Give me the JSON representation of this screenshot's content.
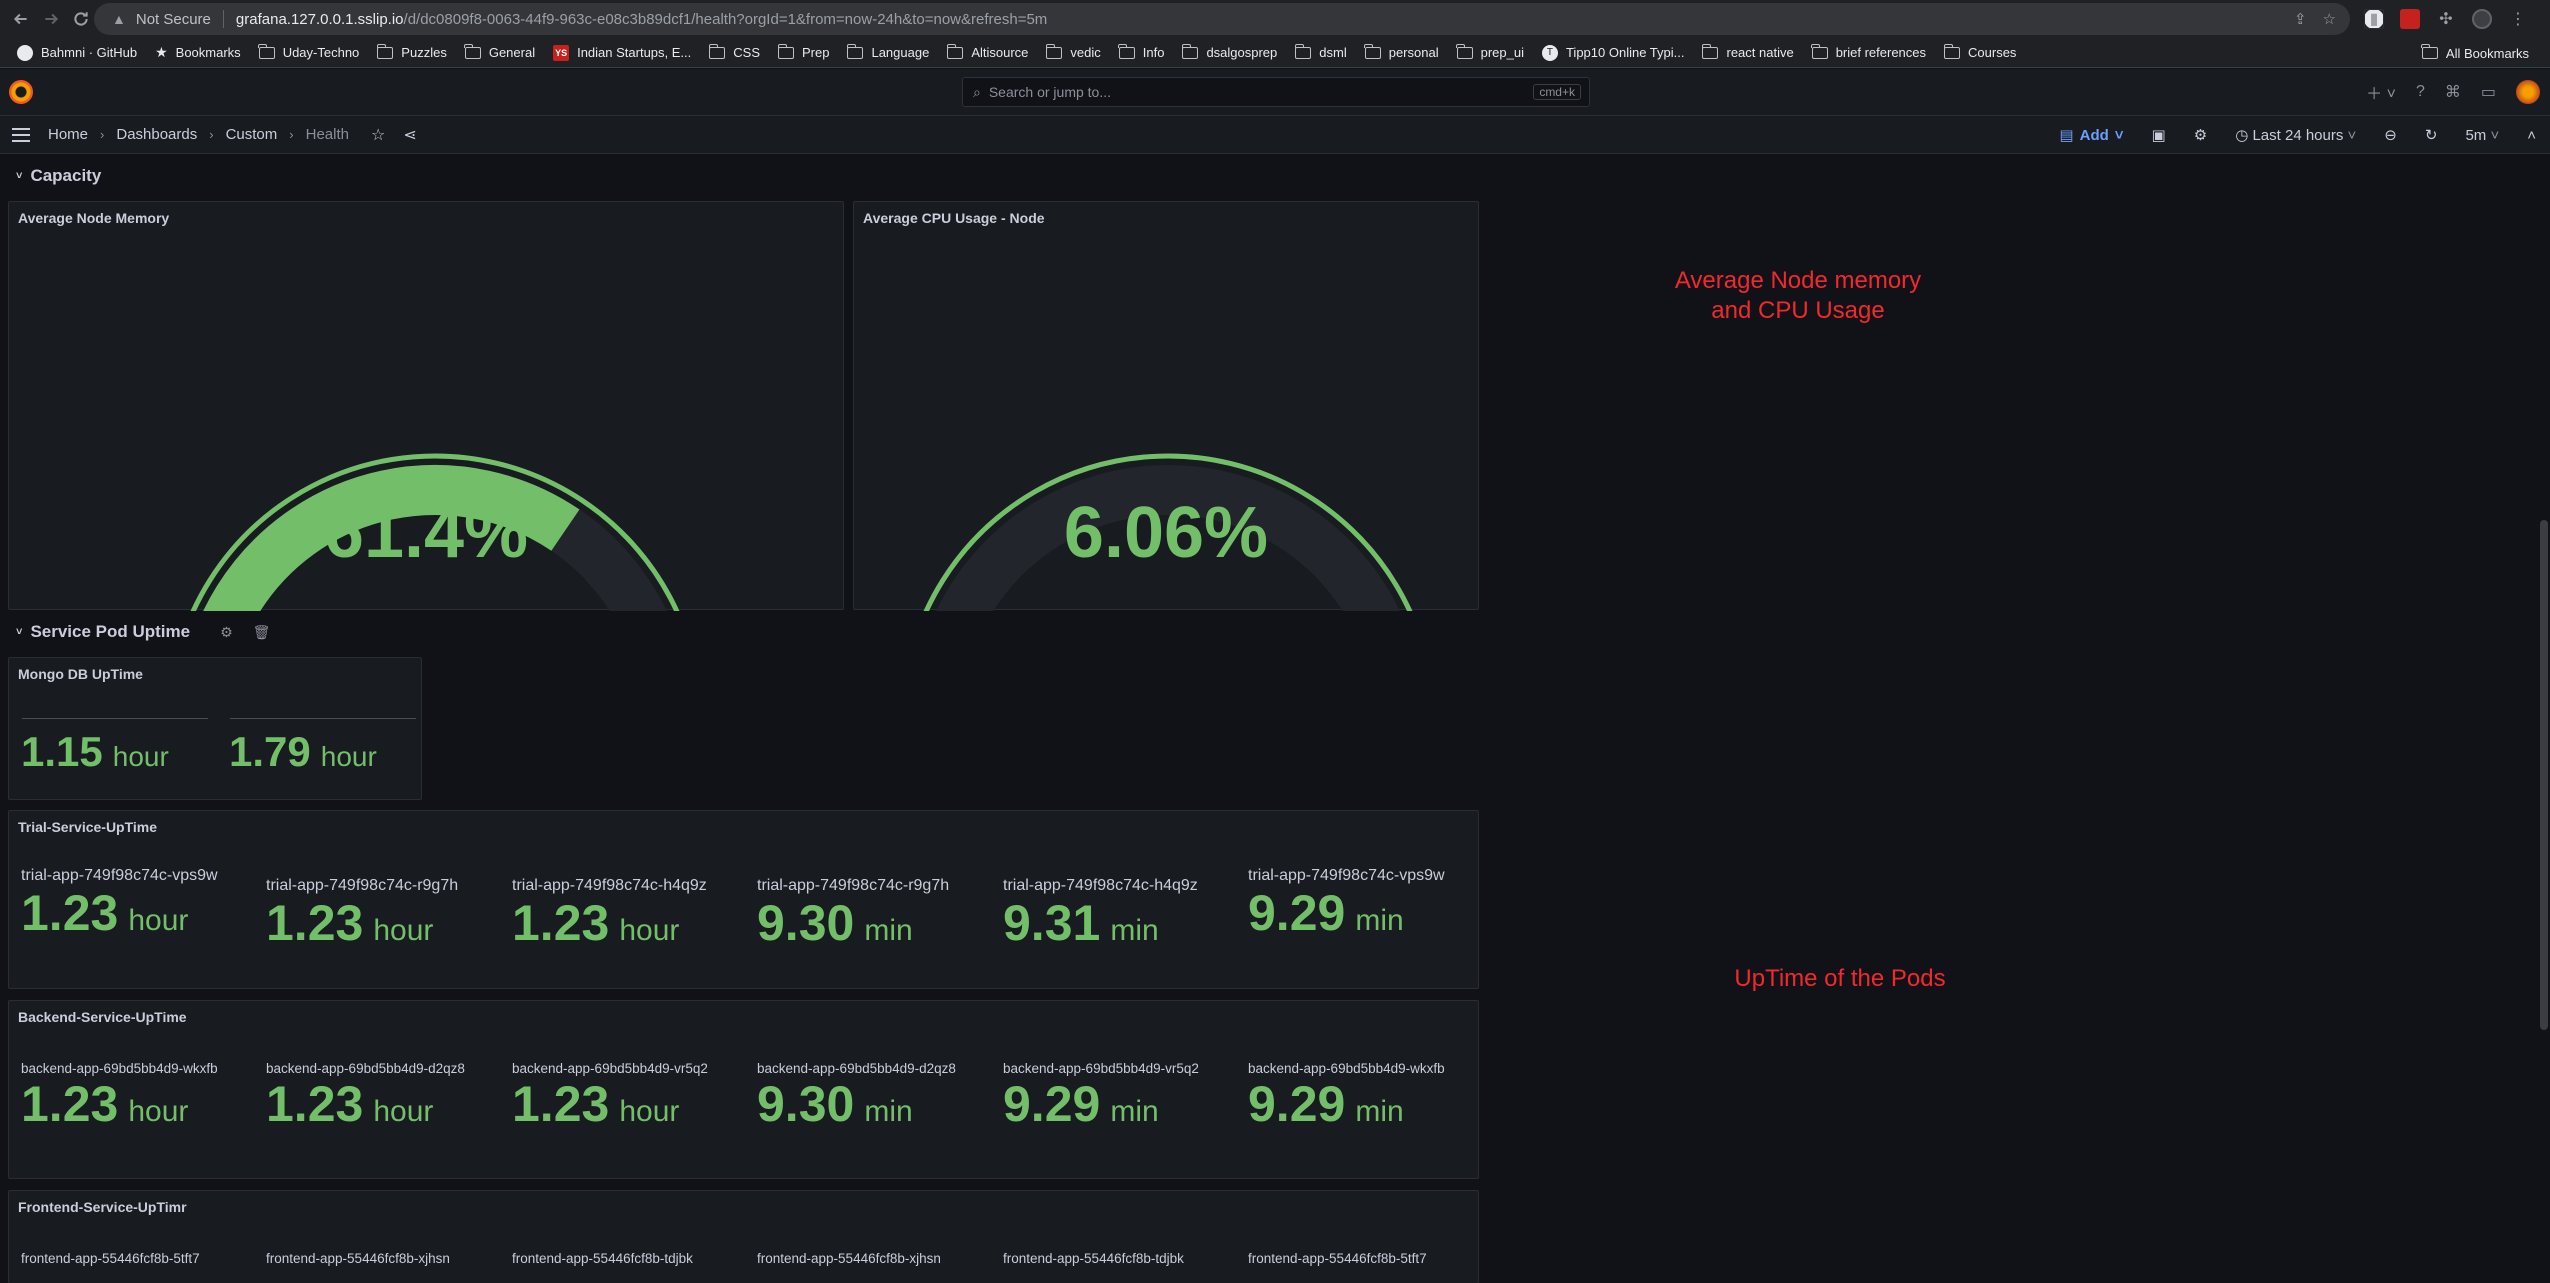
{
  "browser": {
    "not_secure": "Not Secure",
    "url_host": "grafana.127.0.0.1.sslip.io",
    "url_path": "/d/dc0809f8-0063-44f9-963c-e08c3b89dcf1/health?orgId=1&from=now-24h&to=now&refresh=5m",
    "bookmarks": [
      "Bahmni · GitHub",
      "Bookmarks",
      "Uday-Techno",
      "Puzzles",
      "General",
      "Indian Startups, E...",
      "CSS",
      "Prep",
      "Language",
      "Altisource",
      "vedic",
      "Info",
      "dsalgosprep",
      "dsml",
      "personal",
      "prep_ui",
      "Tipp10 Online Typi...",
      "react native",
      "brief references",
      "Courses"
    ],
    "all_bookmarks": "All Bookmarks"
  },
  "grafana": {
    "search_placeholder": "Search or jump to...",
    "search_shortcut": "cmd+k",
    "breadcrumb": [
      "Home",
      "Dashboards",
      "Custom",
      "Health"
    ],
    "add_label": "Add",
    "time_range": "Last 24 hours",
    "refresh_interval": "5m"
  },
  "rows": {
    "capacity": "Capacity",
    "service_pod_uptime": "Service Pod Uptime"
  },
  "gauges": [
    {
      "title": "Average Node Memory",
      "value": "61.4%",
      "fraction": 0.614,
      "threshold": 0.8
    },
    {
      "title": "Average CPU Usage - Node",
      "value": "6.06%",
      "fraction": 0.0606,
      "threshold": 0.8
    }
  ],
  "mongo": {
    "title": "Mongo DB UpTime",
    "stats": [
      {
        "value": "1.15",
        "unit": "hour"
      },
      {
        "value": "1.79",
        "unit": "hour"
      }
    ]
  },
  "trial": {
    "title": "Trial-Service-UpTime",
    "stats": [
      {
        "name": "trial-app-749f98c74c-vps9w",
        "value": "1.23",
        "unit": "hour"
      },
      {
        "name": "trial-app-749f98c74c-r9g7h",
        "value": "1.23",
        "unit": "hour"
      },
      {
        "name": "trial-app-749f98c74c-h4q9z",
        "value": "1.23",
        "unit": "hour"
      },
      {
        "name": "trial-app-749f98c74c-r9g7h",
        "value": "9.30",
        "unit": "min"
      },
      {
        "name": "trial-app-749f98c74c-h4q9z",
        "value": "9.31",
        "unit": "min"
      },
      {
        "name": "trial-app-749f98c74c-vps9w",
        "value": "9.29",
        "unit": "min"
      }
    ]
  },
  "backend": {
    "title": "Backend-Service-UpTime",
    "stats": [
      {
        "name": "backend-app-69bd5bb4d9-wkxfb",
        "value": "1.23",
        "unit": "hour"
      },
      {
        "name": "backend-app-69bd5bb4d9-d2qz8",
        "value": "1.23",
        "unit": "hour"
      },
      {
        "name": "backend-app-69bd5bb4d9-vr5q2",
        "value": "1.23",
        "unit": "hour"
      },
      {
        "name": "backend-app-69bd5bb4d9-d2qz8",
        "value": "9.30",
        "unit": "min"
      },
      {
        "name": "backend-app-69bd5bb4d9-vr5q2",
        "value": "9.29",
        "unit": "min"
      },
      {
        "name": "backend-app-69bd5bb4d9-wkxfb",
        "value": "9.29",
        "unit": "min"
      }
    ]
  },
  "frontend": {
    "title": "Frontend-Service-UpTimr",
    "stats": [
      {
        "name": "frontend-app-55446fcf8b-5tft7"
      },
      {
        "name": "frontend-app-55446fcf8b-xjhsn"
      },
      {
        "name": "frontend-app-55446fcf8b-tdjbk"
      },
      {
        "name": "frontend-app-55446fcf8b-xjhsn"
      },
      {
        "name": "frontend-app-55446fcf8b-tdjbk"
      },
      {
        "name": "frontend-app-55446fcf8b-5tft7"
      }
    ]
  },
  "annotations": {
    "capacity_line1": "Average Node memory",
    "capacity_line2": "and CPU Usage",
    "uptime": "UpTime of the Pods"
  },
  "colors": {
    "green": "#73bf69",
    "red": "#f2495c",
    "track": "#22252b",
    "annotation": "#f2282e"
  }
}
